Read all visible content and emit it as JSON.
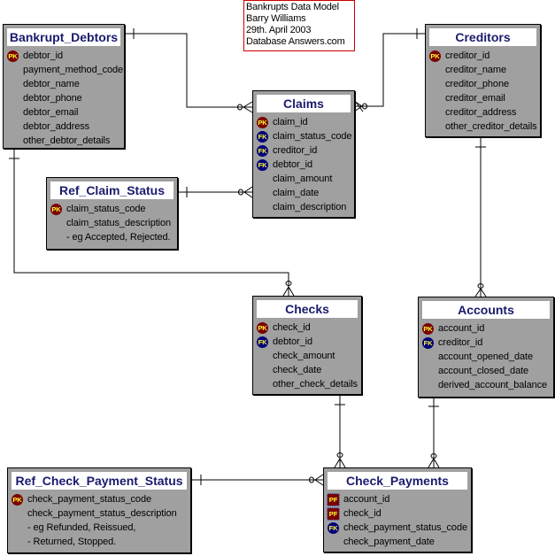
{
  "diagram": {
    "title_note": {
      "lines": [
        "Bankrupts Data Model",
        "Barry Williams",
        "29th. April 2003",
        "Database Answers.com"
      ]
    },
    "key_labels": {
      "pk": "PK",
      "fk": "FK",
      "pf": "PF"
    },
    "colors": {
      "entity_fill": "#a0a0a0",
      "title_text": "#1a1a6e",
      "pk_badge": "#7a0000",
      "fk_badge": "#00007a",
      "note_border": "#cc0000"
    },
    "entities": {
      "bankrupt_debtors": {
        "name": "Bankrupt_Debtors",
        "attributes": [
          {
            "name": "debtor_id",
            "key": "pk"
          },
          {
            "name": "payment_method_code",
            "key": ""
          },
          {
            "name": "debtor_name",
            "key": ""
          },
          {
            "name": "debtor_phone",
            "key": ""
          },
          {
            "name": "debtor_email",
            "key": ""
          },
          {
            "name": "debtor_address",
            "key": ""
          },
          {
            "name": "other_debtor_details",
            "key": ""
          }
        ]
      },
      "claims": {
        "name": "Claims",
        "attributes": [
          {
            "name": "claim_id",
            "key": "pk"
          },
          {
            "name": "claim_status_code",
            "key": "fk"
          },
          {
            "name": "creditor_id",
            "key": "fk"
          },
          {
            "name": "debtor_id",
            "key": "fk"
          },
          {
            "name": "claim_amount",
            "key": ""
          },
          {
            "name": "claim_date",
            "key": ""
          },
          {
            "name": "claim_description",
            "key": ""
          }
        ]
      },
      "creditors": {
        "name": "Creditors",
        "attributes": [
          {
            "name": "creditor_id",
            "key": "pk"
          },
          {
            "name": "creditor_name",
            "key": ""
          },
          {
            "name": "creditor_phone",
            "key": ""
          },
          {
            "name": "creditor_email",
            "key": ""
          },
          {
            "name": "creditor_address",
            "key": ""
          },
          {
            "name": "other_creditor_details",
            "key": ""
          }
        ]
      },
      "ref_claim_status": {
        "name": "Ref_Claim_Status",
        "attributes": [
          {
            "name": "claim_status_code",
            "key": "pk"
          },
          {
            "name": "claim_status_description",
            "key": ""
          },
          {
            "name": "- eg Accepted, Rejected.",
            "key": ""
          }
        ]
      },
      "checks": {
        "name": "Checks",
        "attributes": [
          {
            "name": "check_id",
            "key": "pk"
          },
          {
            "name": "debtor_id",
            "key": "fk"
          },
          {
            "name": "check_amount",
            "key": ""
          },
          {
            "name": "check_date",
            "key": ""
          },
          {
            "name": "other_check_details",
            "key": ""
          }
        ]
      },
      "accounts": {
        "name": "Accounts",
        "attributes": [
          {
            "name": "account_id",
            "key": "pk"
          },
          {
            "name": "creditor_id",
            "key": "fk"
          },
          {
            "name": "account_opened_date",
            "key": ""
          },
          {
            "name": "account_closed_date",
            "key": ""
          },
          {
            "name": "derived_account_balance",
            "key": ""
          }
        ]
      },
      "ref_check_payment_status": {
        "name": "Ref_Check_Payment_Status",
        "attributes": [
          {
            "name": "check_payment_status_code",
            "key": "pk"
          },
          {
            "name": "check_payment_status_description",
            "key": ""
          },
          {
            "name": "- eg Refunded, Reissued,",
            "key": ""
          },
          {
            "name": "-       Returned, Stopped.",
            "key": ""
          }
        ]
      },
      "check_payments": {
        "name": "Check_Payments",
        "attributes": [
          {
            "name": "account_id",
            "key": "pf"
          },
          {
            "name": "check_id",
            "key": "pf"
          },
          {
            "name": "check_payment_status_code",
            "key": "fk"
          },
          {
            "name": "check_payment_date",
            "key": ""
          }
        ]
      }
    },
    "relationships": [
      {
        "from": "Bankrupt_Debtors",
        "to": "Claims",
        "cardinality": "one-to-zero-or-many"
      },
      {
        "from": "Creditors",
        "to": "Claims",
        "cardinality": "one-to-zero-or-many"
      },
      {
        "from": "Ref_Claim_Status",
        "to": "Claims",
        "cardinality": "one-to-zero-or-many"
      },
      {
        "from": "Bankrupt_Debtors",
        "to": "Checks",
        "cardinality": "one-to-zero-or-many"
      },
      {
        "from": "Creditors",
        "to": "Accounts",
        "cardinality": "one-to-zero-or-many"
      },
      {
        "from": "Checks",
        "to": "Check_Payments",
        "cardinality": "one-to-zero-or-many"
      },
      {
        "from": "Accounts",
        "to": "Check_Payments",
        "cardinality": "one-to-zero-or-many"
      },
      {
        "from": "Ref_Check_Payment_Status",
        "to": "Check_Payments",
        "cardinality": "one-to-zero-or-many"
      }
    ]
  }
}
